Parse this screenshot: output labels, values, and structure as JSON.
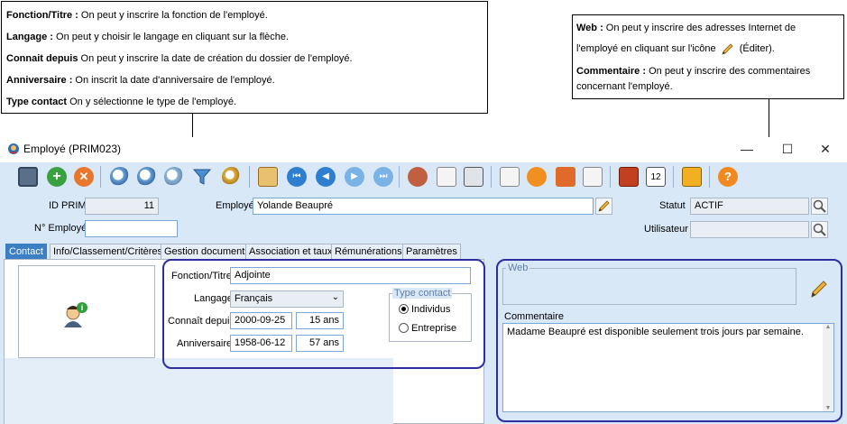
{
  "callouts": {
    "left": [
      {
        "label": "Fonction/Titre :",
        "text": " On peut y inscrire la fonction de l'employé."
      },
      {
        "label": "Langage :",
        "text": " On peut y choisir le langage en cliquant sur la flèche."
      },
      {
        "label": "Connait depuis",
        "text": "   On peut y inscrire la date de création du dossier de l'employé."
      },
      {
        "label": "Anniversaire :",
        "text": " On inscrit la date d'anniversaire de l'employé."
      },
      {
        "label": "Type contact",
        "text": "   On y  sélectionne le type de l'employé."
      }
    ],
    "right": {
      "web_label": "Web :",
      "web_line1": " On peut y inscrire des adresses Internet de",
      "web_line2a": "l'employé en cliquant sur l'icône",
      "web_line2b": "(Éditer).",
      "comment_label": "Commentaire :",
      "comment_line1": " On peut y inscrire des commentaires",
      "comment_line2": "concernant l'employé."
    }
  },
  "window": {
    "title": "Employé (PRIM023)",
    "minimize": "—",
    "maximize": "☐",
    "close": "✕"
  },
  "toolbar": {
    "icons": [
      "save-icon",
      "add-icon",
      "delete-icon",
      "search-icon",
      "search-edit-icon",
      "search-clear-icon",
      "filter-icon",
      "key-search-icon",
      "report-icon",
      "first-icon",
      "previous-icon",
      "next-icon",
      "last-icon",
      "contacts-icon",
      "email-icon",
      "phone-icon",
      "checklist-icon",
      "refresh-icon",
      "download-icon",
      "document-icon",
      "calculator-icon",
      "calendar-icon",
      "lock-icon",
      "help-icon"
    ]
  },
  "header": {
    "id_prim_label": "ID PRIM",
    "id_prim_value": "11",
    "no_employe_label": "N° Employé",
    "no_employe_value": "",
    "employe_label": "Employé",
    "employe_value": "Yolande Beaupré",
    "statut_label": "Statut",
    "statut_value": "ACTIF",
    "utilisateur_label": "Utilisateur",
    "utilisateur_value": ""
  },
  "tabs": [
    {
      "label": "Contact",
      "active": true
    },
    {
      "label": "Info/Classement/Critères",
      "active": false
    },
    {
      "label": "Gestion documents",
      "active": false
    },
    {
      "label": "Association et taux",
      "active": false
    },
    {
      "label": "Rémunérations",
      "active": false
    },
    {
      "label": "Paramètres",
      "active": false
    }
  ],
  "contact": {
    "fonction_label": "Fonction/Titre",
    "fonction_value": "Adjointe",
    "langage_label": "Langage",
    "langage_value": "Français",
    "connait_label": "Connaît depuis",
    "connait_date": "2000-09-25",
    "connait_years": "15 ans",
    "anniversaire_label": "Anniversaire",
    "anniversaire_date": "1958-06-12",
    "anniversaire_years": "57 ans",
    "type_contact_label": "Type contact",
    "type_options": [
      {
        "label": "Individus",
        "selected": true
      },
      {
        "label": "Entreprise",
        "selected": false
      }
    ]
  },
  "right_panel": {
    "web_label": "Web",
    "web_value": "",
    "comment_label": "Commentaire",
    "comment_value": "Madame Beaupré est disponible seulement trois jours par semaine."
  }
}
